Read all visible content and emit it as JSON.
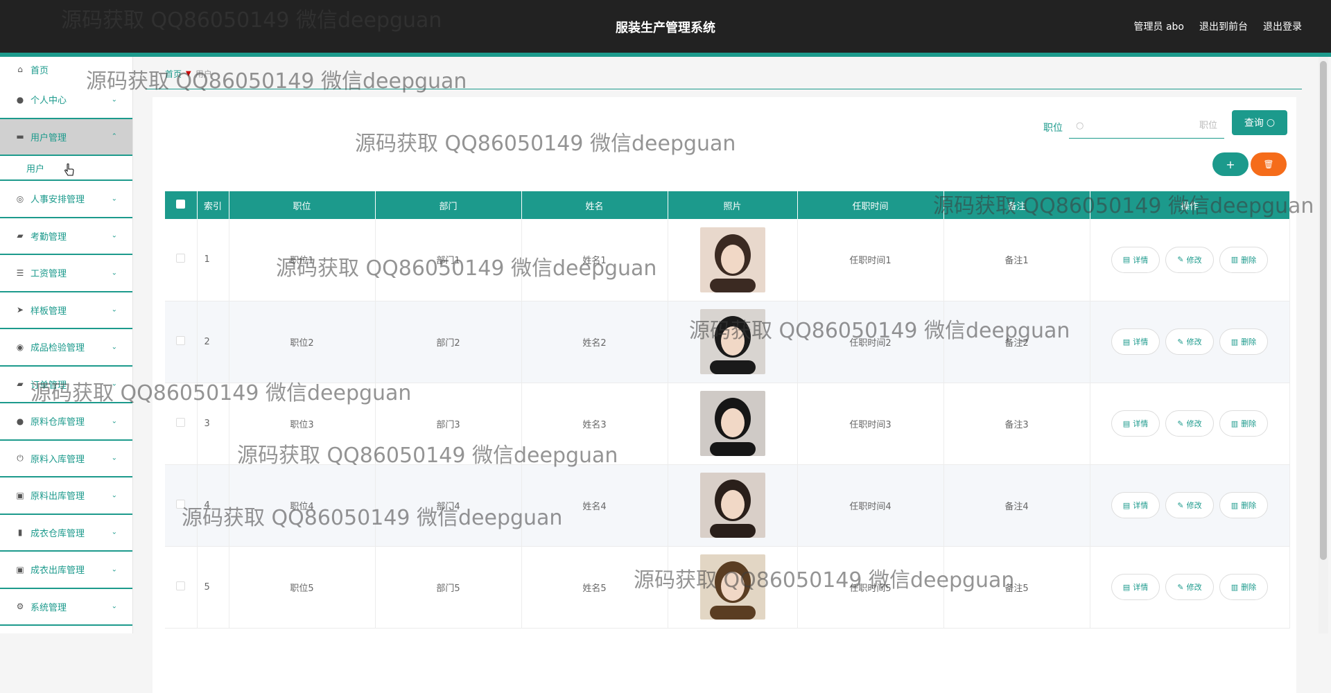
{
  "header": {
    "app_title": "服装生产管理系统",
    "user_label": "管理员 abo",
    "front_link": "退出到前台",
    "logout_link": "退出登录"
  },
  "sidebar": {
    "home": "首页",
    "items": [
      {
        "label": "个人中心",
        "icon": "person-icon"
      },
      {
        "label": "用户管理",
        "icon": "users-icon",
        "expanded": true
      },
      {
        "label": "人事安排管理",
        "icon": "compass-icon"
      },
      {
        "label": "考勤管理",
        "icon": "chat-icon"
      },
      {
        "label": "工资管理",
        "icon": "list-icon"
      },
      {
        "label": "样板管理",
        "icon": "send-icon"
      },
      {
        "label": "成品检验管理",
        "icon": "target-icon"
      },
      {
        "label": "订单管理",
        "icon": "order-icon"
      },
      {
        "label": "原料仓库管理",
        "icon": "person-icon"
      },
      {
        "label": "原料入库管理",
        "icon": "power-icon"
      },
      {
        "label": "原料出库管理",
        "icon": "clipboard-icon"
      },
      {
        "label": "成衣仓库管理",
        "icon": "chart-icon"
      },
      {
        "label": "成衣出库管理",
        "icon": "clipboard-icon"
      },
      {
        "label": "系统管理",
        "icon": "settings-icon"
      }
    ],
    "submenu_user": "用户"
  },
  "breadcrumb": {
    "home": "首页",
    "current": "用户"
  },
  "search": {
    "label": "职位",
    "placeholder": "职位",
    "query_button": "查询"
  },
  "toolbar": {
    "add": "+",
    "delete": "🗑"
  },
  "table": {
    "columns": [
      "索引",
      "职位",
      "部门",
      "姓名",
      "照片",
      "任职时间",
      "备注",
      "操作"
    ],
    "rows": [
      {
        "index": "1",
        "position": "职位1",
        "department": "部门1",
        "name": "姓名1",
        "tenure": "任职时间1",
        "note": "备注1"
      },
      {
        "index": "2",
        "position": "职位2",
        "department": "部门2",
        "name": "姓名2",
        "tenure": "任职时间2",
        "note": "备注2"
      },
      {
        "index": "3",
        "position": "职位3",
        "department": "部门3",
        "name": "姓名3",
        "tenure": "任职时间3",
        "note": "备注3"
      },
      {
        "index": "4",
        "position": "职位4",
        "department": "部门4",
        "name": "姓名4",
        "tenure": "任职时间4",
        "note": "备注4"
      },
      {
        "index": "5",
        "position": "职位5",
        "department": "部门5",
        "name": "姓名5",
        "tenure": "任职时间5",
        "note": "备注5"
      }
    ],
    "actions": {
      "detail": "详情",
      "edit": "修改",
      "delete": "删除"
    }
  },
  "watermark": "源码获取 QQ86050149 微信deepguan",
  "colors": {
    "primary": "#1c9a8c",
    "danger": "#f56c1a",
    "header_bg": "#222222"
  }
}
